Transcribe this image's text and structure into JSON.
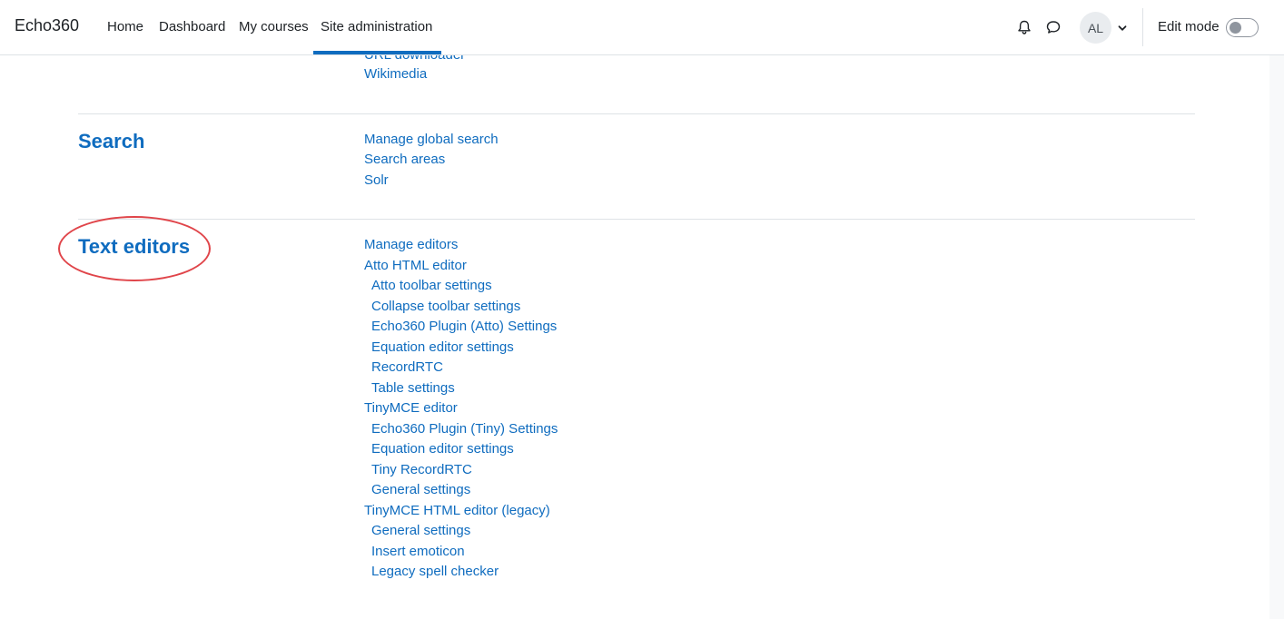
{
  "navbar": {
    "brand": "Echo360",
    "items": [
      "Home",
      "Dashboard",
      "My courses",
      "Site administration"
    ],
    "active_item": "Site administration",
    "avatar_initials": "AL",
    "edit_mode_label": "Edit mode",
    "edit_mode_on": false
  },
  "partial_top_links": [
    "URL downloader",
    "Wikimedia"
  ],
  "sections": {
    "search": {
      "heading": "Search",
      "links": [
        "Manage global search",
        "Search areas",
        "Solr"
      ]
    },
    "text_editors": {
      "heading": "Text editors",
      "links": {
        "manage": "Manage editors",
        "atto": "Atto HTML editor",
        "atto_sub": [
          "Atto toolbar settings",
          "Collapse toolbar settings",
          "Echo360 Plugin (Atto) Settings",
          "Equation editor settings",
          "RecordRTC",
          "Table settings"
        ],
        "tiny": "TinyMCE editor",
        "tiny_sub": [
          "Echo360 Plugin (Tiny) Settings",
          "Equation editor settings",
          "Tiny RecordRTC",
          "General settings"
        ],
        "tiny_legacy": "TinyMCE HTML editor (legacy)",
        "tiny_legacy_sub": [
          "General settings",
          "Insert emoticon",
          "Legacy spell checker"
        ]
      }
    }
  },
  "colors": {
    "link": "#0f6cbf",
    "annotation": "#e0454a"
  }
}
